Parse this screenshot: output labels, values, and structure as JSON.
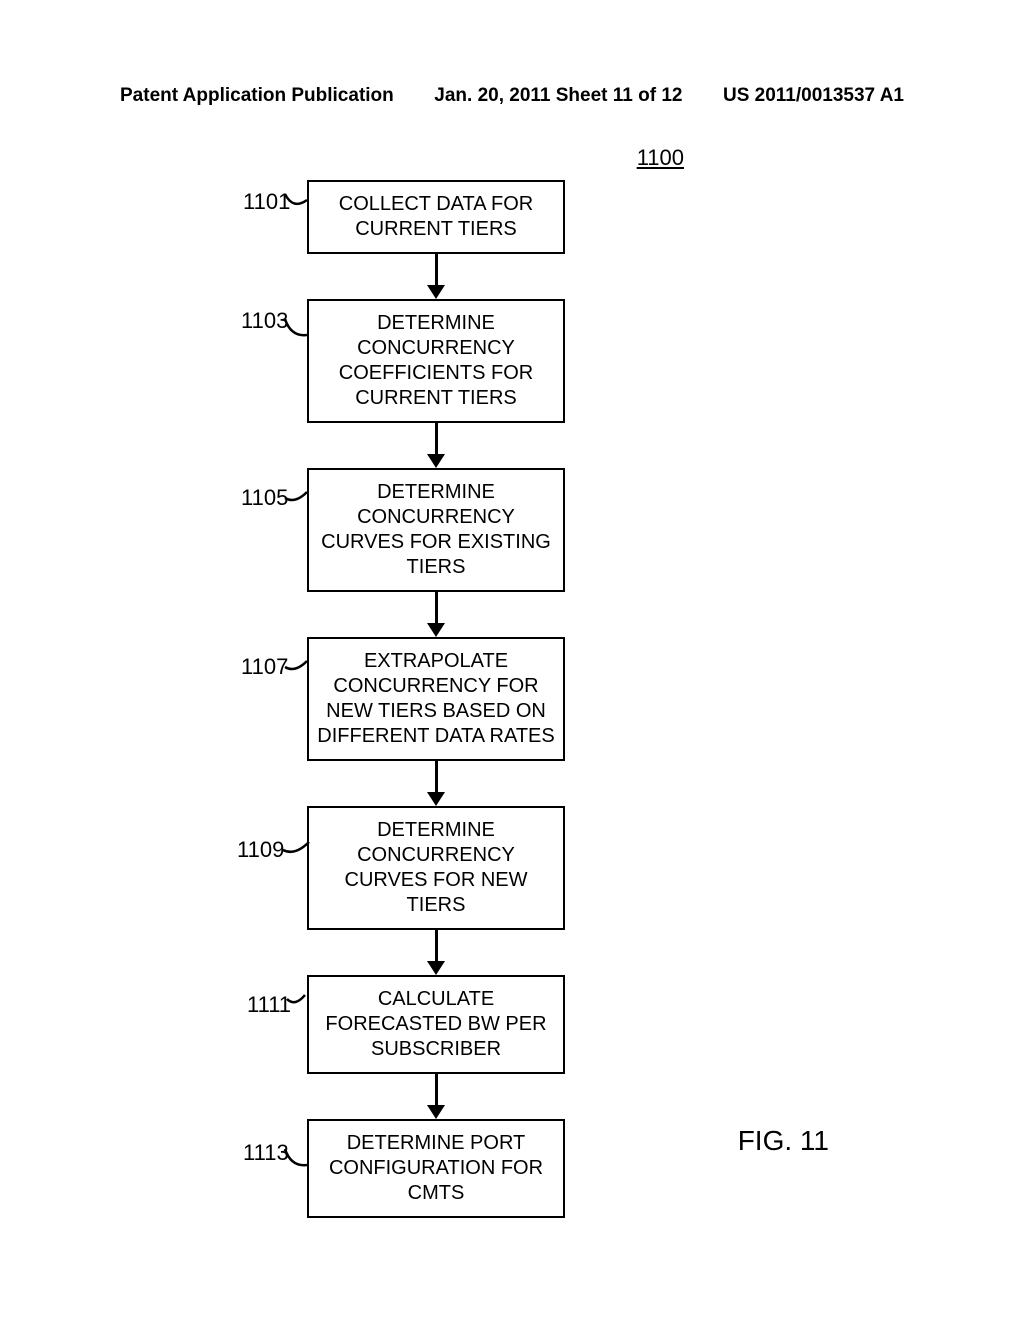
{
  "header": {
    "left": "Patent Application Publication",
    "center": "Jan. 20, 2011  Sheet 11 of 12",
    "right": "US 2011/0013537 A1"
  },
  "diagram_number": "1100",
  "figure_label": "FIG. 11",
  "steps": [
    {
      "label": "1101",
      "text": "COLLECT DATA FOR CURRENT TIERS"
    },
    {
      "label": "1103",
      "text": "DETERMINE CONCURRENCY COEFFICIENTS FOR CURRENT TIERS"
    },
    {
      "label": "1105",
      "text": "DETERMINE CONCURRENCY CURVES FOR EXISTING TIERS"
    },
    {
      "label": "1107",
      "text": "EXTRAPOLATE CONCURRENCY FOR NEW TIERS BASED ON DIFFERENT DATA RATES"
    },
    {
      "label": "1109",
      "text": "DETERMINE CONCURRENCY CURVES FOR NEW TIERS"
    },
    {
      "label": "1111",
      "text": "CALCULATE FORECASTED BW PER SUBSCRIBER"
    },
    {
      "label": "1113",
      "text": "DETERMINE PORT CONFIGURATION FOR CMTS"
    }
  ]
}
